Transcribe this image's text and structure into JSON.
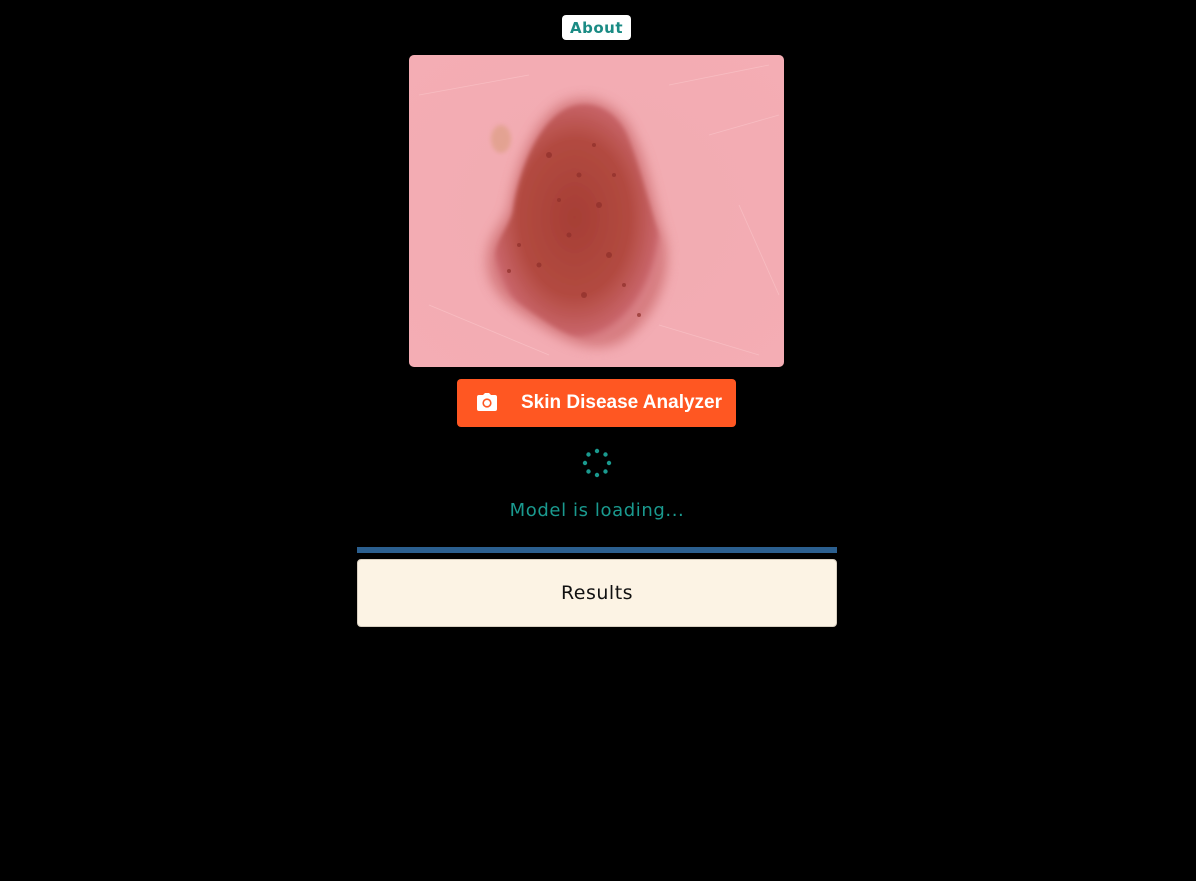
{
  "header": {
    "about_label": "About"
  },
  "preview": {
    "image_name": "skin-lesion-photo"
  },
  "analyzer": {
    "button_label": "Skin Disease Analyzer",
    "icon": "camera-icon",
    "accent_color": "#ff5722"
  },
  "status": {
    "spinner_icon": "loading-spinner-icon",
    "message": "Model is loading...",
    "message_color": "#1a9a8f",
    "progress_fraction": 1.0,
    "progress_color": "#2b5f8f"
  },
  "results": {
    "title": "Results",
    "background_color": "#fcf3e4"
  }
}
